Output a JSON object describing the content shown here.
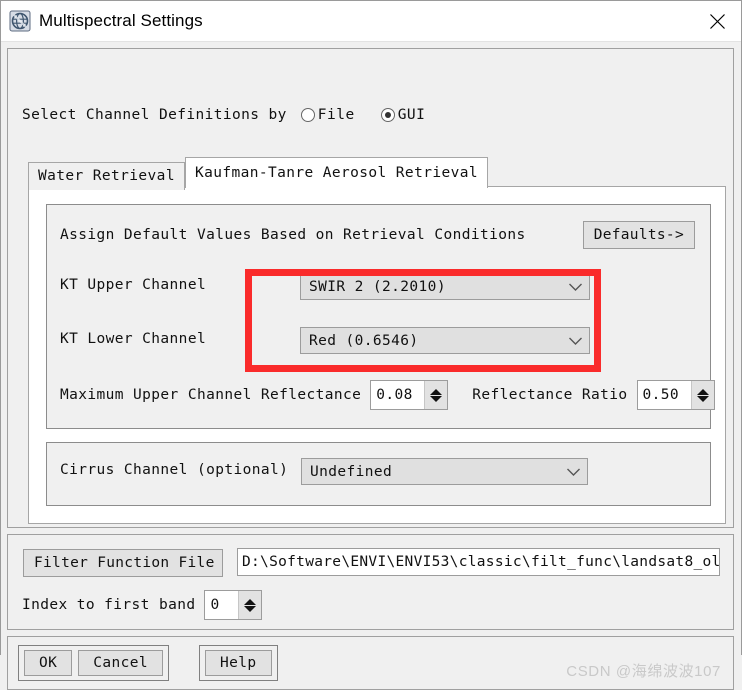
{
  "window": {
    "title": "Multispectral Settings",
    "icon": "globe-icon",
    "close_label": "×"
  },
  "channel_definitions": {
    "label": "Select Channel Definitions by",
    "options": [
      {
        "label": "File",
        "selected": false
      },
      {
        "label": "GUI",
        "selected": true
      }
    ]
  },
  "tabs": [
    {
      "label": "Water Retrieval",
      "active": false
    },
    {
      "label": "Kaufman-Tanre Aerosol Retrieval",
      "active": true
    }
  ],
  "aerosol_panel": {
    "defaults_row": {
      "label": "Assign Default Values Based on Retrieval Conditions",
      "button": "Defaults->"
    },
    "upper_channel": {
      "label": "KT Upper Channel",
      "value": "SWIR 2 (2.2010)"
    },
    "lower_channel": {
      "label": "KT Lower Channel",
      "value": "Red (0.6546)"
    },
    "max_reflectance": {
      "label": "Maximum Upper Channel Reflectance",
      "value": "0.08"
    },
    "reflectance_ratio": {
      "label": "Reflectance Ratio",
      "value": "0.50"
    },
    "cirrus_channel": {
      "label": "Cirrus Channel (optional)",
      "value": "Undefined"
    },
    "annotation": {
      "name": "red-highlight-box",
      "color": "#fa2b2b"
    }
  },
  "filter_section": {
    "button_label": "Filter Function File",
    "path_value": "D:\\Software\\ENVI\\ENVI53\\classic\\filt_func\\landsat8_ol",
    "index_label": "Index to first band",
    "index_value": "0"
  },
  "buttons": {
    "ok": "OK",
    "cancel": "Cancel",
    "help": "Help"
  },
  "watermark": "CSDN @海绵波波107"
}
